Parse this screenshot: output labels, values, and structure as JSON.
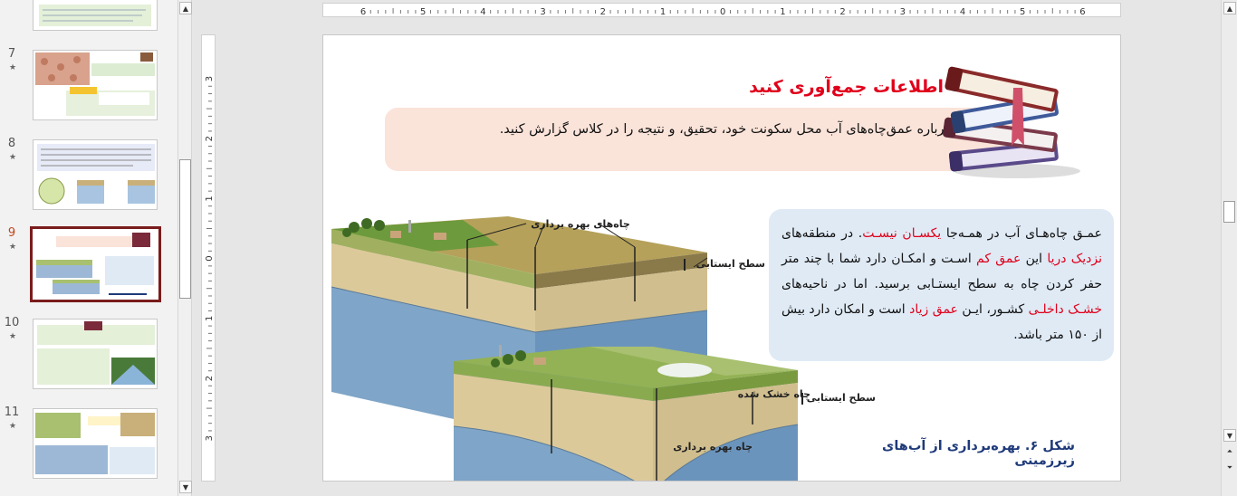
{
  "thumbnails": [
    {
      "number": "",
      "star": ""
    },
    {
      "number": "7",
      "star": "★"
    },
    {
      "number": "8",
      "star": "★"
    },
    {
      "number": "9",
      "star": "★"
    },
    {
      "number": "10",
      "star": "★"
    },
    {
      "number": "11",
      "star": "★"
    }
  ],
  "hruler_labels": [
    "6",
    "5",
    "4",
    "3",
    "2",
    "1",
    "0",
    "1",
    "2",
    "3",
    "4",
    "5",
    "6"
  ],
  "vruler_labels": [
    "3",
    "2",
    "1",
    "0",
    "1",
    "2",
    "3"
  ],
  "slide": {
    "heading": "اطلاعات جمع‌آوری کنید",
    "instruction": "درباره عمق‌چاه‌های آب محل سکونت خود، تحقیق، و نتیجه را در کلاس گزارش کنید.",
    "explanation": {
      "p1": "عمـق چاه‌هـای آب در همـه‌جا ",
      "r1": "یکسـان نیسـت",
      "p2": ". در منطقه‌های ",
      "r2": "نزدیک دریا",
      "p3": " این ",
      "r3": "عمق کم",
      "p4": " اسـت و امکـان دارد شما با چند متر حفر کردن چاه به سطح ایستـابی برسید. اما در ناحیه‌های ",
      "r4": "خشـک داخلـی",
      "p5": " کشـور، ایـن ",
      "r5": "عمق زیاد",
      "p6": " است و امکان دارد بیش از ۱۵۰ متر باشد."
    },
    "diagram": {
      "wells_label": "چاه‌های بهره برداری",
      "water_table_label": "سطح ایستابی",
      "water_table_label_2": "سطح ایستابی",
      "dry_well_label": "چاه خشک شده",
      "exploit_well_label": "چاه بهره برداری"
    },
    "caption": "شکل ۶. بهره‌برداری از آب‌های زیرزمینی"
  },
  "colors": {
    "accent_red": "#e0001b",
    "selected_border": "#7a1c1c",
    "instruction_box": "#fae3d9",
    "explanation_box": "#dfeaf5",
    "caption": "#1f3a7a"
  }
}
